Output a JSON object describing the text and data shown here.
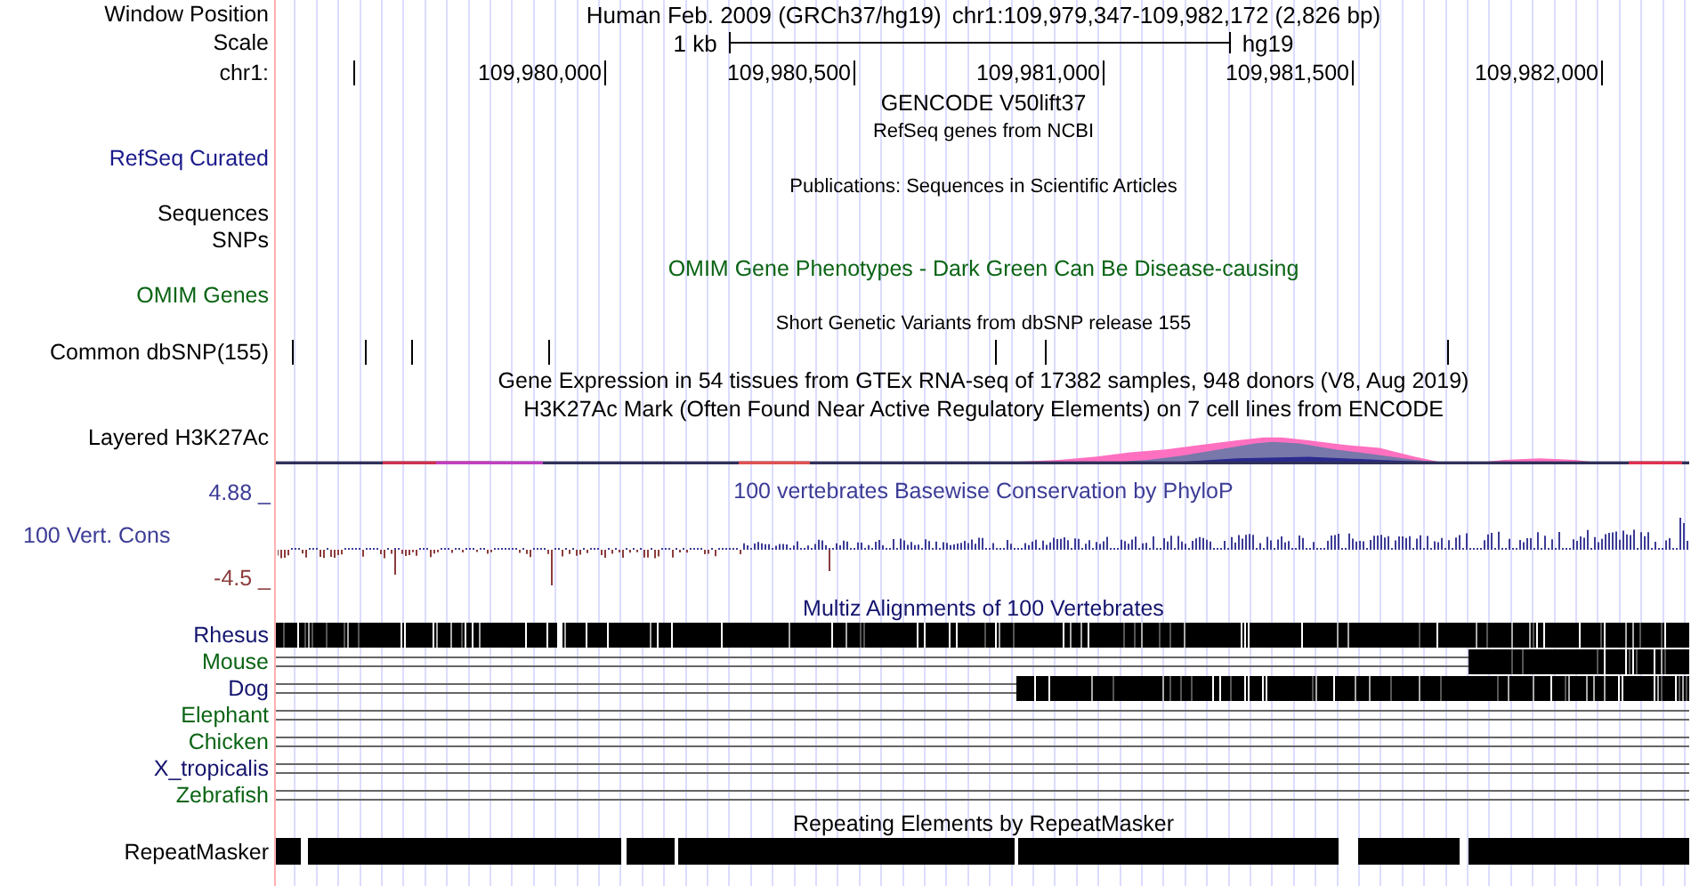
{
  "header": {
    "window_position_label": "Window Position",
    "assembly": "Human Feb. 2009 (GRCh37/hg19)",
    "position": "chr1:109,979,347-109,982,172 (2,826 bp)",
    "scale_label": "Scale",
    "scale_length": "1 kb",
    "scale_db": "hg19",
    "chrom_label": "chr1:",
    "ticks": [
      "109,980,000",
      "109,980,500",
      "109,981,000",
      "109,981,500",
      "109,982,000"
    ]
  },
  "tracks": [
    {
      "kind": "title",
      "title": "GENCODE V50lift37",
      "color": "#000000"
    },
    {
      "kind": "small-title",
      "title": "RefSeq genes from NCBI"
    },
    {
      "kind": "empty",
      "label": "RefSeq Curated",
      "color": "#1a1a8c"
    },
    {
      "kind": "small-title",
      "title": "Publications: Sequences in Scientific Articles"
    },
    {
      "kind": "empty",
      "label": "Sequences",
      "color": "#000000"
    },
    {
      "kind": "empty",
      "label": "SNPs",
      "color": "#000000"
    },
    {
      "kind": "title",
      "title": "OMIM Gene Phenotypes - Dark Green Can Be Disease-causing",
      "color": "#0a6414"
    },
    {
      "kind": "empty",
      "label": "OMIM Genes",
      "color": "#0a6414"
    },
    {
      "kind": "small-title",
      "title": "Short Genetic Variants from dbSNP release 155"
    },
    {
      "kind": "snps",
      "label": "Common dbSNP(155)",
      "color": "#000000"
    },
    {
      "kind": "title",
      "title": "Gene Expression in 54 tissues from GTEx RNA-seq of 17382 samples, 948 donors (V8, Aug 2019)",
      "color": "#000000"
    },
    {
      "kind": "title",
      "title": "H3K27Ac Mark (Often Found Near Active Regulatory Elements) on 7 cell lines from ENCODE",
      "color": "#000000"
    },
    {
      "kind": "layered",
      "label": "Layered H3K27Ac",
      "color": "#000000"
    },
    {
      "kind": "phylop",
      "title": "100 vertebrates Basewise Conservation by PhyloP",
      "label": "100 Vert. Cons",
      "max": "4.88 _",
      "min": "-4.5 _",
      "color": "#3c3c96"
    },
    {
      "kind": "title",
      "title": "Multiz Alignments of 100 Vertebrates",
      "color": "#14146e"
    },
    {
      "kind": "multiz",
      "species": [
        {
          "label": "Rhesus",
          "color": "#14146e",
          "kind": "full"
        },
        {
          "label": "Mouse",
          "color": "#0a6414",
          "kind": "partial"
        },
        {
          "label": "Dog",
          "color": "#14146e",
          "kind": "partial"
        },
        {
          "label": "Elephant",
          "color": "#0a6414",
          "kind": "none"
        },
        {
          "label": "Chicken",
          "color": "#0a6414",
          "kind": "none"
        },
        {
          "label": "X_tropicalis",
          "color": "#14146e",
          "kind": "none"
        },
        {
          "label": "Zebrafish",
          "color": "#0a6414",
          "kind": "none"
        }
      ]
    },
    {
      "kind": "title",
      "title": "Repeating Elements by RepeatMasker",
      "color": "#000000"
    },
    {
      "kind": "repeats",
      "label": "RepeatMasker",
      "color": "#000000"
    }
  ]
}
